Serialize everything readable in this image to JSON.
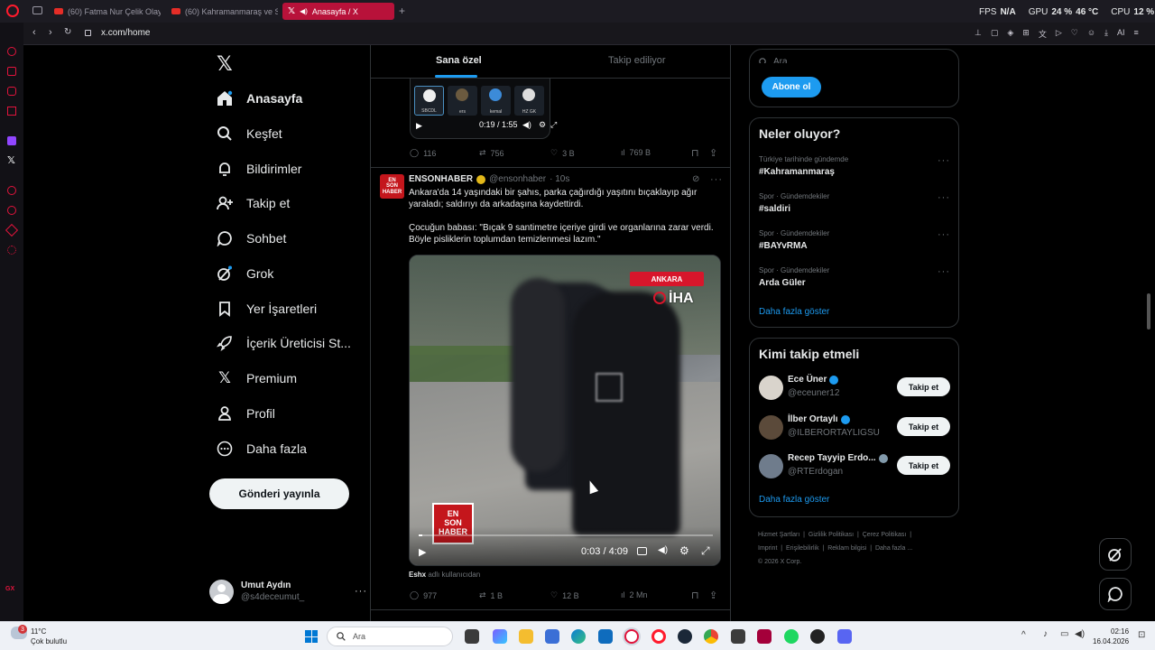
{
  "browser": {
    "tabs": [
      {
        "label": "(60) Fatma Nur Çelik Olay"
      },
      {
        "label": "(60) Kahramanmaraş ve S"
      },
      {
        "label": "Anasayfa / X"
      }
    ],
    "url": "x.com/home",
    "stats": {
      "fps_label": "FPS",
      "fps_value": "N/A",
      "gpu_label": "GPU",
      "gpu_value": "24 %",
      "gpu_temp": "46 °C",
      "cpu_label": "CPU",
      "cpu_value": "12 %"
    },
    "ai_label": "AI"
  },
  "sidebar": {
    "items": [
      {
        "label": "Anasayfa",
        "icon": "home-icon"
      },
      {
        "label": "Keşfet",
        "icon": "search-icon"
      },
      {
        "label": "Bildirimler",
        "icon": "bell-icon"
      },
      {
        "label": "Takip et",
        "icon": "follow-icon"
      },
      {
        "label": "Sohbet",
        "icon": "chat-icon"
      },
      {
        "label": "Grok",
        "icon": "grok-icon"
      },
      {
        "label": "Yer İşaretleri",
        "icon": "bookmark-icon"
      },
      {
        "label": "İçerik Üreticisi St...",
        "icon": "rocket-icon"
      },
      {
        "label": "Premium",
        "icon": "x-logo-icon"
      },
      {
        "label": "Profil",
        "icon": "person-icon"
      },
      {
        "label": "Daha fazla",
        "icon": "more-circle-icon"
      }
    ],
    "post_button": "Gönderi yayınla",
    "account": {
      "name": "Umut Aydın",
      "handle": "@s4deceumut_"
    }
  },
  "feed": {
    "tabs": [
      "Sana özel",
      "Takip ediliyor"
    ],
    "prev_tweet": {
      "video_time": "0:19 / 1:55",
      "space_names": [
        "SBCDL",
        "ers",
        "kemal",
        "HZ GK"
      ],
      "replies": "116",
      "reposts": "756",
      "likes": "3 B",
      "views": "769 B"
    },
    "tweet": {
      "name": "ENSONHABER",
      "handle": "@ensonhaber",
      "time": "· 10s",
      "text1": "Ankara'da 14 yaşındaki bir şahıs, parka çağırdığı yaşıtını bıçaklayıp ağır yaraladı; saldırıyı da arkadaşına kaydettirdi.",
      "text2": "Çocuğun babası: \"Bıçak 9 santimetre içeriye girdi ve organlarına zarar verdi. Böyle pisliklerin toplumdan temizlenmesi lazım.\"",
      "video_location": "ANKARA",
      "video_brand": "İHA",
      "video_time": "0:03 / 4:09",
      "video_progress": 0.012,
      "logo_lines": [
        "EN",
        "SON",
        "HABER"
      ],
      "caption_user": "Eshx",
      "caption_suffix": "adlı kullanıcıdan",
      "replies": "977",
      "reposts": "1 B",
      "likes": "12 B",
      "views": "2 Mn"
    }
  },
  "right": {
    "search_placeholder": "Ara",
    "subscribe": "Abone ol",
    "trends_title": "Neler oluyor?",
    "trends": [
      {
        "category": "Türkiye tarihinde gündemde",
        "name": "#Kahramanmaraş"
      },
      {
        "category": "Spor · Gündemdekiler",
        "name": "#saldiri"
      },
      {
        "category": "Spor · Gündemdekiler",
        "name": "#BAYvRMA"
      },
      {
        "category": "Spor · Gündemdekiler",
        "name": "Arda Güler"
      }
    ],
    "trends_more": "Daha fazla göster",
    "who_title": "Kimi takip etmeli",
    "who": [
      {
        "name": "Ece Üner",
        "handle": "@eceuner12",
        "verified": true,
        "button": "Takip et"
      },
      {
        "name": "İlber Ortaylı",
        "handle": "@ILBERORTAYLIGSU",
        "verified": true,
        "button": "Takip et"
      },
      {
        "name": "Recep Tayyip Erdo...",
        "handle": "@RTErdogan",
        "verified": true,
        "button": "Takip et"
      }
    ],
    "who_more": "Daha fazla göster",
    "footer_links": [
      "Hizmet Şartları",
      "Gizlilik Politikası",
      "Çerez Politikası",
      "Imprint",
      "Erişilebilirlik",
      "Reklam bilgisi",
      "Daha fazla ..."
    ],
    "copyright": "© 2026 X Corp."
  },
  "taskbar": {
    "weather_temp": "11°C",
    "weather_desc": "Çok bulutlu",
    "weather_badge": "3",
    "search": "Ara",
    "time": "02:16",
    "date": "16.04.2026"
  },
  "colors": {
    "accent": "#1d9bf0",
    "opera_red": "#e0143c",
    "verified": "#1d9bf0",
    "iha_red": "#d7162b"
  }
}
